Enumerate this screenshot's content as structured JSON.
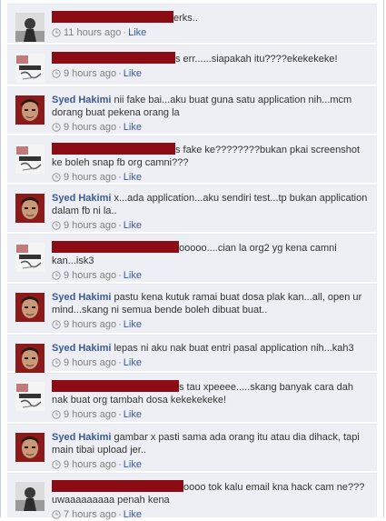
{
  "comments": [
    {
      "type": "redacted",
      "avatar": "girl-photo-avatar",
      "text": "erks..",
      "time": "11 hours ago",
      "sep": "·",
      "like": "Like"
    },
    {
      "type": "redacted",
      "avatar": "sketch-avatar",
      "text": "s err......siapakah itu????ekekekeke!",
      "time": "9 hours ago",
      "sep": "·",
      "like": "Like"
    },
    {
      "type": "author",
      "author": "Syed Hakimi",
      "avatar": "syed-hakimi-avatar",
      "text": "nii fake bai...aku buat guna satu application nih...mcm dorang buat pekena orang la",
      "time": "9 hours ago",
      "sep": "·",
      "like": "Like"
    },
    {
      "type": "redacted",
      "avatar": "sketch-avatar",
      "text": "s fake ke????????bukan pkai screenshot ke boleh snap fb org camni???",
      "time": "9 hours ago",
      "sep": "·",
      "like": "Like"
    },
    {
      "type": "author",
      "author": "Syed Hakimi",
      "avatar": "syed-hakimi-avatar",
      "text": "x...ada application...aku sendiri test...tp bukan application dalam fb ni la..",
      "time": "9 hours ago",
      "sep": "·",
      "like": "Like"
    },
    {
      "type": "redacted",
      "avatar": "sketch-avatar",
      "text": "ooooo....cian la org2 yg kena camni kan...isk3",
      "time": "9 hours ago",
      "sep": "·",
      "like": "Like"
    },
    {
      "type": "author",
      "author": "Syed Hakimi",
      "avatar": "syed-hakimi-avatar",
      "text": "pastu kena kutuk ramai buat dosa plak kan...all, open ur mind...skang ni semua bende boleh dibuat buat..",
      "time": "9 hours ago",
      "sep": "·",
      "like": "Like"
    },
    {
      "type": "author",
      "author": "Syed Hakimi",
      "avatar": "syed-hakimi-avatar",
      "text": "lepas ni aku nak buat entri pasal application nih...kah3",
      "time": "9 hours ago",
      "sep": "·",
      "like": "Like"
    },
    {
      "type": "redacted",
      "avatar": "sketch-avatar",
      "text": "s tau xpeeee.....skang banyak cara dah nak buat org tambah dosa kekekekeke!",
      "time": "9 hours ago",
      "sep": "·",
      "like": "Like"
    },
    {
      "type": "author",
      "author": "Syed Hakimi",
      "avatar": "syed-hakimi-avatar",
      "text": "gambar x pasti sama ada orang itu atau dia dihack, tapi main tibai upload jer..",
      "time": "9 hours ago",
      "sep": "·",
      "like": "Like"
    },
    {
      "type": "redacted",
      "avatar": "girl-photo-avatar",
      "text": "oooo tok kalu email kna hack cam ne??? uwaaaaaaaaa penah kena",
      "time": "7 hours ago",
      "sep": "·",
      "like": "Like"
    }
  ],
  "colors": {
    "author": "#3b5998",
    "redaction": "#8b0c14",
    "background": "#edeff4",
    "meta": "#808080"
  }
}
